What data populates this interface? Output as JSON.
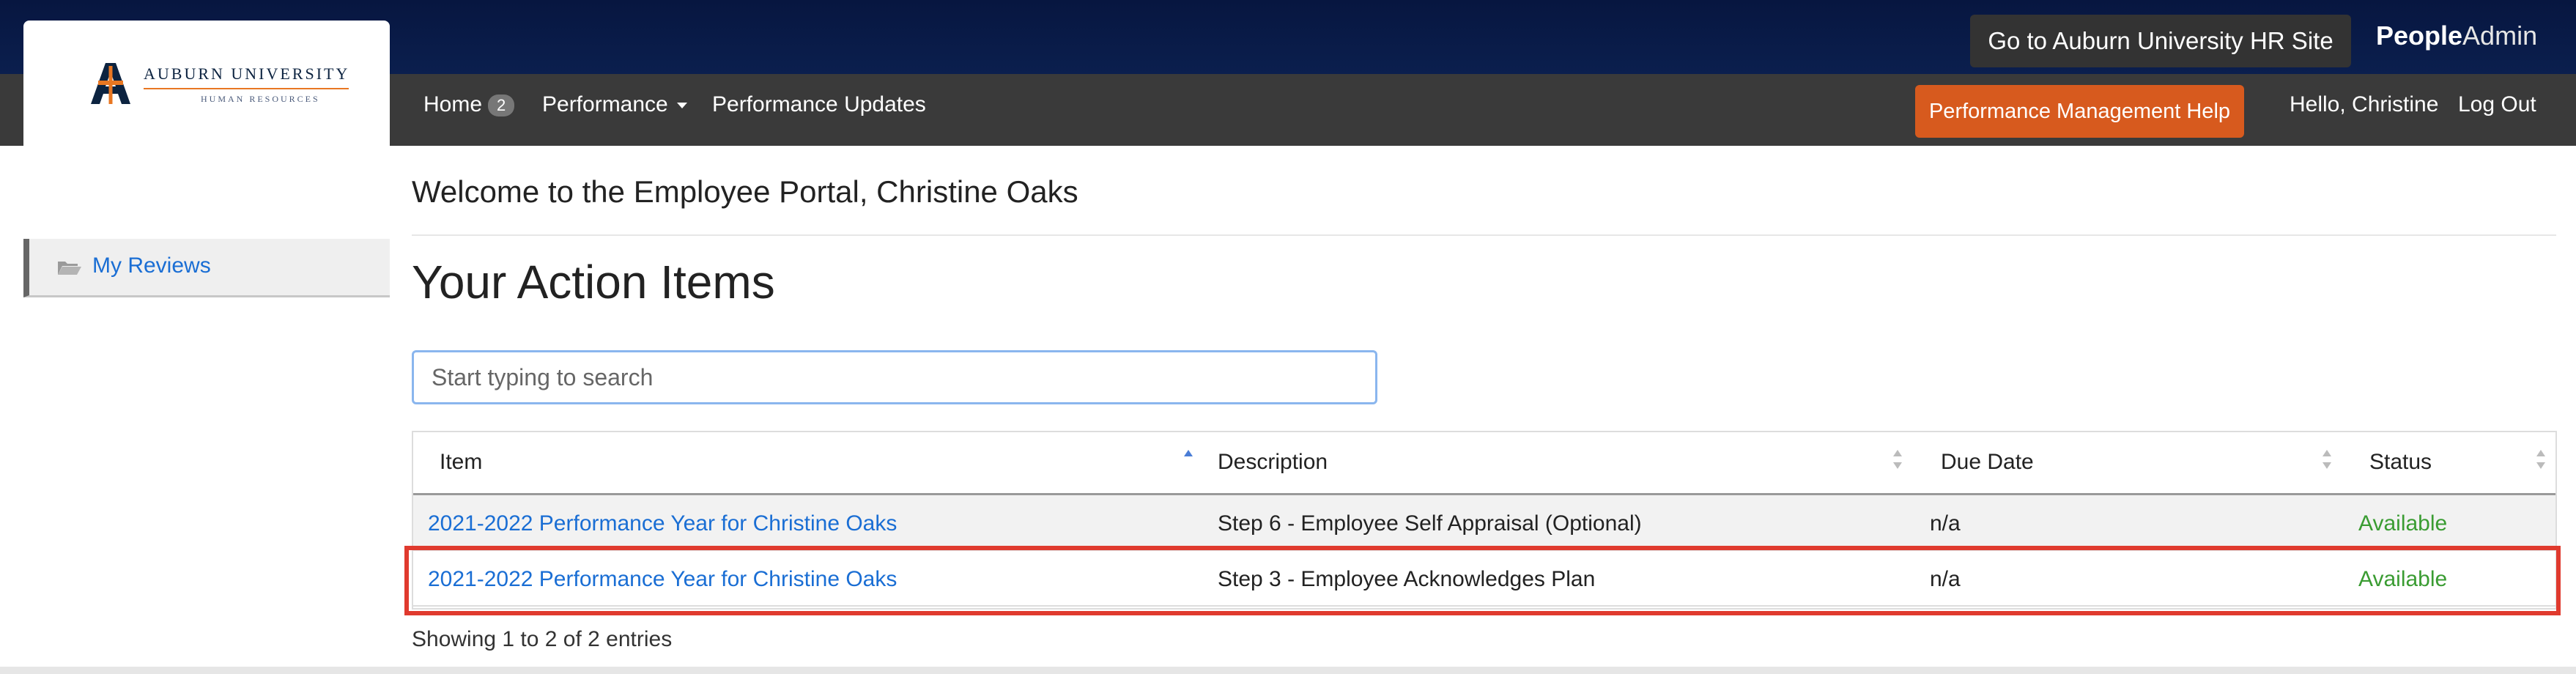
{
  "brand": {
    "university_name": "AUBURN UNIVERSITY",
    "department": "HUMAN RESOURCES",
    "people_admin_bold": "People",
    "people_admin_light": "Admin"
  },
  "topbar": {
    "hr_site_button": "Go to Auburn University HR Site"
  },
  "nav": {
    "home_label": "Home",
    "home_badge": "2",
    "performance_label": "Performance",
    "performance_updates_label": "Performance Updates",
    "help_button": "Performance Management Help",
    "greeting": "Hello, Christine",
    "logout": "Log Out"
  },
  "sidebar": {
    "items": [
      {
        "label": "My Reviews",
        "icon": "folder-open-icon"
      }
    ]
  },
  "main": {
    "welcome": "Welcome to the Employee Portal, Christine Oaks",
    "title": "Your Action Items",
    "search_placeholder": "Start typing to search",
    "columns": [
      "Item",
      "Description",
      "Due Date",
      "Status"
    ],
    "rows": [
      {
        "item": "2021-2022 Performance Year for Christine Oaks",
        "description": "Step 6 - Employee Self Appraisal (Optional)",
        "due": "n/a",
        "status": "Available"
      },
      {
        "item": "2021-2022 Performance Year for Christine Oaks",
        "description": "Step 3 - Employee Acknowledges Plan",
        "due": "n/a",
        "status": "Available"
      }
    ],
    "footer": "Showing 1 to 2 of 2 entries"
  },
  "colors": {
    "topbar": "#0b1f4e",
    "navbar": "#3a3a3a",
    "help_button": "#d75a1e",
    "link": "#1a6ed4",
    "status_ok": "#3a9c32",
    "highlight": "#e03a2e"
  }
}
